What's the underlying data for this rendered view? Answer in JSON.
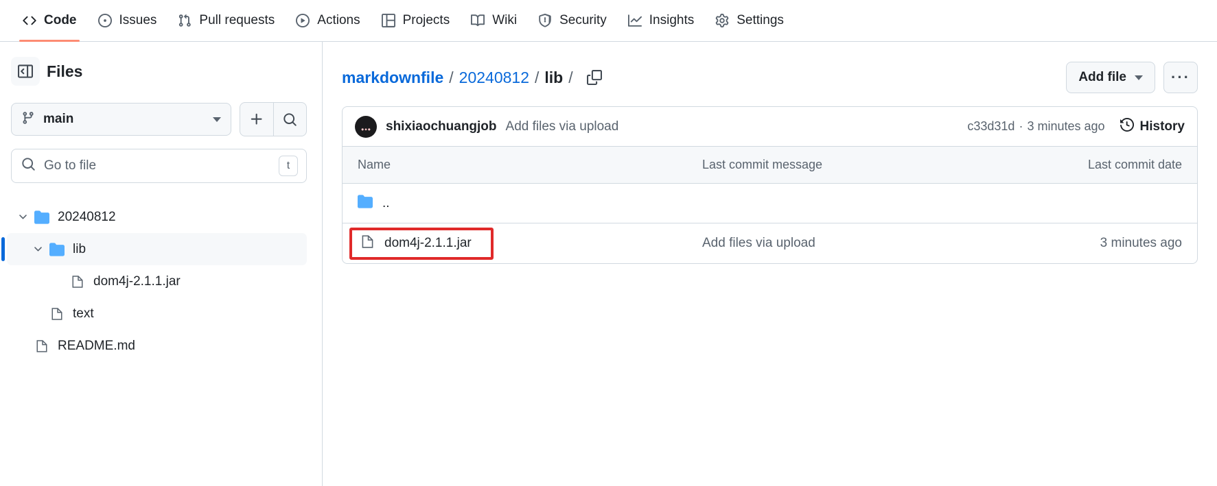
{
  "repo_nav": {
    "items": [
      {
        "label": "Code",
        "icon": "code-icon",
        "active": true
      },
      {
        "label": "Issues",
        "icon": "issue-opened-icon",
        "active": false
      },
      {
        "label": "Pull requests",
        "icon": "git-pull-request-icon",
        "active": false
      },
      {
        "label": "Actions",
        "icon": "play-icon",
        "active": false
      },
      {
        "label": "Projects",
        "icon": "table-icon",
        "active": false
      },
      {
        "label": "Wiki",
        "icon": "book-icon",
        "active": false
      },
      {
        "label": "Security",
        "icon": "shield-icon",
        "active": false
      },
      {
        "label": "Insights",
        "icon": "graph-icon",
        "active": false
      },
      {
        "label": "Settings",
        "icon": "gear-icon",
        "active": false
      }
    ]
  },
  "sidebar": {
    "title": "Files",
    "collapse_icon": "sidebar-collapse-icon",
    "branch": {
      "name": "main",
      "icon": "git-branch-icon"
    },
    "add_button_icon": "plus-icon",
    "search_button_icon": "search-icon",
    "go_to_file": {
      "placeholder": "Go to file",
      "value": "",
      "icon": "search-icon",
      "shortcut": "t"
    },
    "tree": [
      {
        "label": "20240812",
        "type": "folder",
        "expanded": true,
        "depth": 0,
        "selected": false
      },
      {
        "label": "lib",
        "type": "folder",
        "expanded": true,
        "depth": 1,
        "selected": true
      },
      {
        "label": "dom4j-2.1.1.jar",
        "type": "file",
        "expanded": false,
        "depth": 2,
        "selected": false
      },
      {
        "label": "text",
        "type": "file",
        "expanded": false,
        "depth": 1,
        "selected": false
      },
      {
        "label": "README.md",
        "type": "file",
        "expanded": false,
        "depth": 0,
        "selected": false
      }
    ]
  },
  "main": {
    "breadcrumb": {
      "parts": [
        {
          "label": "markdownfile",
          "link": true,
          "bold": true
        },
        {
          "label": "20240812",
          "link": true,
          "bold": false
        },
        {
          "label": "lib",
          "link": false,
          "bold": true
        }
      ],
      "trailing_separator": "/",
      "copy_icon": "copy-path-icon"
    },
    "actions": {
      "add_file_label": "Add file",
      "more_options_icon": "kebab-horizontal-icon"
    },
    "commit": {
      "author": "shixiaochuangjob",
      "message": "Add files via upload",
      "sha": "c33d31d",
      "separator": "·",
      "relative_time": "3 minutes ago",
      "history_label": "History",
      "history_icon": "history-clock-icon"
    },
    "file_table": {
      "columns": [
        "Name",
        "Last commit message",
        "Last commit date"
      ],
      "rows": [
        {
          "name": "..",
          "type": "folder-parent",
          "icon": "folder-icon",
          "message": "",
          "date": "",
          "highlighted": false
        },
        {
          "name": "dom4j-2.1.1.jar",
          "type": "file",
          "icon": "file-icon",
          "message": "Add files via upload",
          "date": "3 minutes ago",
          "highlighted": true
        }
      ]
    }
  },
  "colors": {
    "accent": "#0969da",
    "active_tab_underline": "#fd8c73",
    "folder_blue": "#54aeff",
    "highlight_red": "#e02a2a",
    "border": "#d1d9e0",
    "muted_text": "#59636e"
  }
}
